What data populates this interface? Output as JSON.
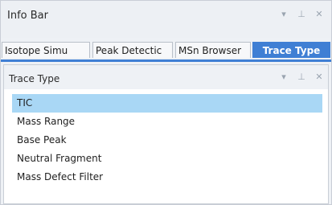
{
  "info_bar": {
    "title": "Info Bar",
    "dropdown_glyph": "▾",
    "pin_glyph": "⊥",
    "close_glyph": "✕"
  },
  "tabs": [
    {
      "label": "Isotope Simu"
    },
    {
      "label": "Peak Detectic"
    },
    {
      "label": "MSn Browser"
    },
    {
      "label": "Trace Type"
    }
  ],
  "active_tab": "Trace Type",
  "trace_panel": {
    "title": "Trace Type",
    "dropdown_glyph": "▾",
    "pin_glyph": "⊥",
    "close_glyph": "✕",
    "items": [
      {
        "label": "TIC",
        "selected": true
      },
      {
        "label": "Mass Range"
      },
      {
        "label": "Base Peak"
      },
      {
        "label": "Neutral Fragment"
      },
      {
        "label": "Mass Defect Filter"
      }
    ]
  },
  "colors": {
    "accent": "#3f7fd4",
    "selection": "#a9d7f5"
  }
}
